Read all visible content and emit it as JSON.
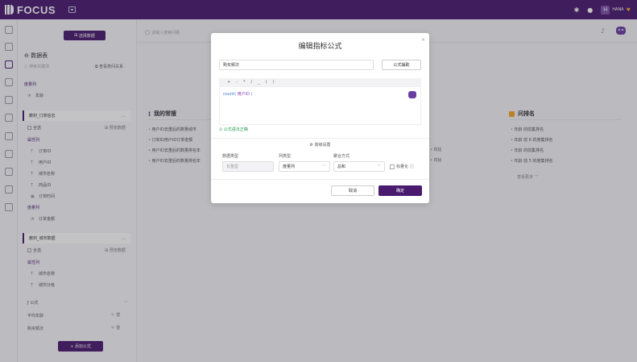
{
  "app": {
    "name": "FOCUS",
    "user_initial": "H",
    "user_name": "HANA"
  },
  "icons": {
    "logo": "focus-logo-icon",
    "grid": "grid-icon",
    "notification": "bell-icon",
    "help": "help-icon",
    "heart": "heart-icon",
    "mic": "microphone-icon",
    "assistant": "robot-icon"
  },
  "colors": {
    "brand": "#4a1a6e",
    "accent": "#f5a623",
    "link_green": "#2e9c5a",
    "function_blue": "#3d7ad6"
  },
  "sidebar": {
    "select_data_button": "选择数据",
    "dataset_title": "数据表",
    "search_placeholder": "搜索关键词",
    "view_relations": "查看表间关系",
    "metrics_group": "度量列",
    "metric_field": "年龄",
    "tables": [
      {
        "name": "教材_订单信息",
        "select_all": "全选",
        "preview": "预览数据",
        "attr_group": "属性列",
        "attributes": [
          "订单ID",
          "用户ID",
          "城市名称",
          "商品ID",
          "订单时间"
        ],
        "metric_group": "度量列",
        "metrics": [
          "订单金额"
        ]
      },
      {
        "name": "教材_城市数据",
        "select_all": "全选",
        "preview": "预览数据",
        "attr_group": "属性列",
        "attributes": [
          "城市名称",
          "城市分级"
        ]
      }
    ],
    "formula_group": "公式",
    "formulas": [
      "平均年龄",
      "购买频次"
    ],
    "add_formula_button": "+ 添加公式"
  },
  "main": {
    "search_placeholder": "请输入搜索问题",
    "cards": [
      {
        "title": "我的常搜",
        "items": [
          "用户ID去重后的数量城市",
          "订单ID用户ID订单金额",
          "用户ID去重后的数量排名年",
          "用户ID去重后的数量排名年"
        ]
      },
      {
        "title": "问排名",
        "items": [
          "年龄 的前集排名",
          "年龄 前 6 的度集排名",
          "年龄 的前集排名",
          "年龄 前 5 的度集排名"
        ],
        "more": "查看更多"
      }
    ],
    "partial_items": [
      "均比",
      "均比"
    ]
  },
  "modal": {
    "title": "编辑指标公式",
    "formula_name": "购买频次",
    "assist_button": "公式辅助",
    "operators": [
      "+",
      "-",
      "*",
      "/",
      "_",
      "(",
      ")"
    ],
    "expression": {
      "function": "count(",
      "argument": "用户ID",
      "closing": ")"
    },
    "syntax_link": "公式语法正确",
    "advanced_title": "高级设置",
    "data_type_label": "数据类型",
    "data_type_value": "长整型",
    "column_type_label": "列类型",
    "column_type_value": "度量列",
    "aggregation_label": "聚合方式",
    "aggregation_value": "总和",
    "normalize_label": "标量化",
    "cancel_button": "取消",
    "ok_button": "确定"
  }
}
